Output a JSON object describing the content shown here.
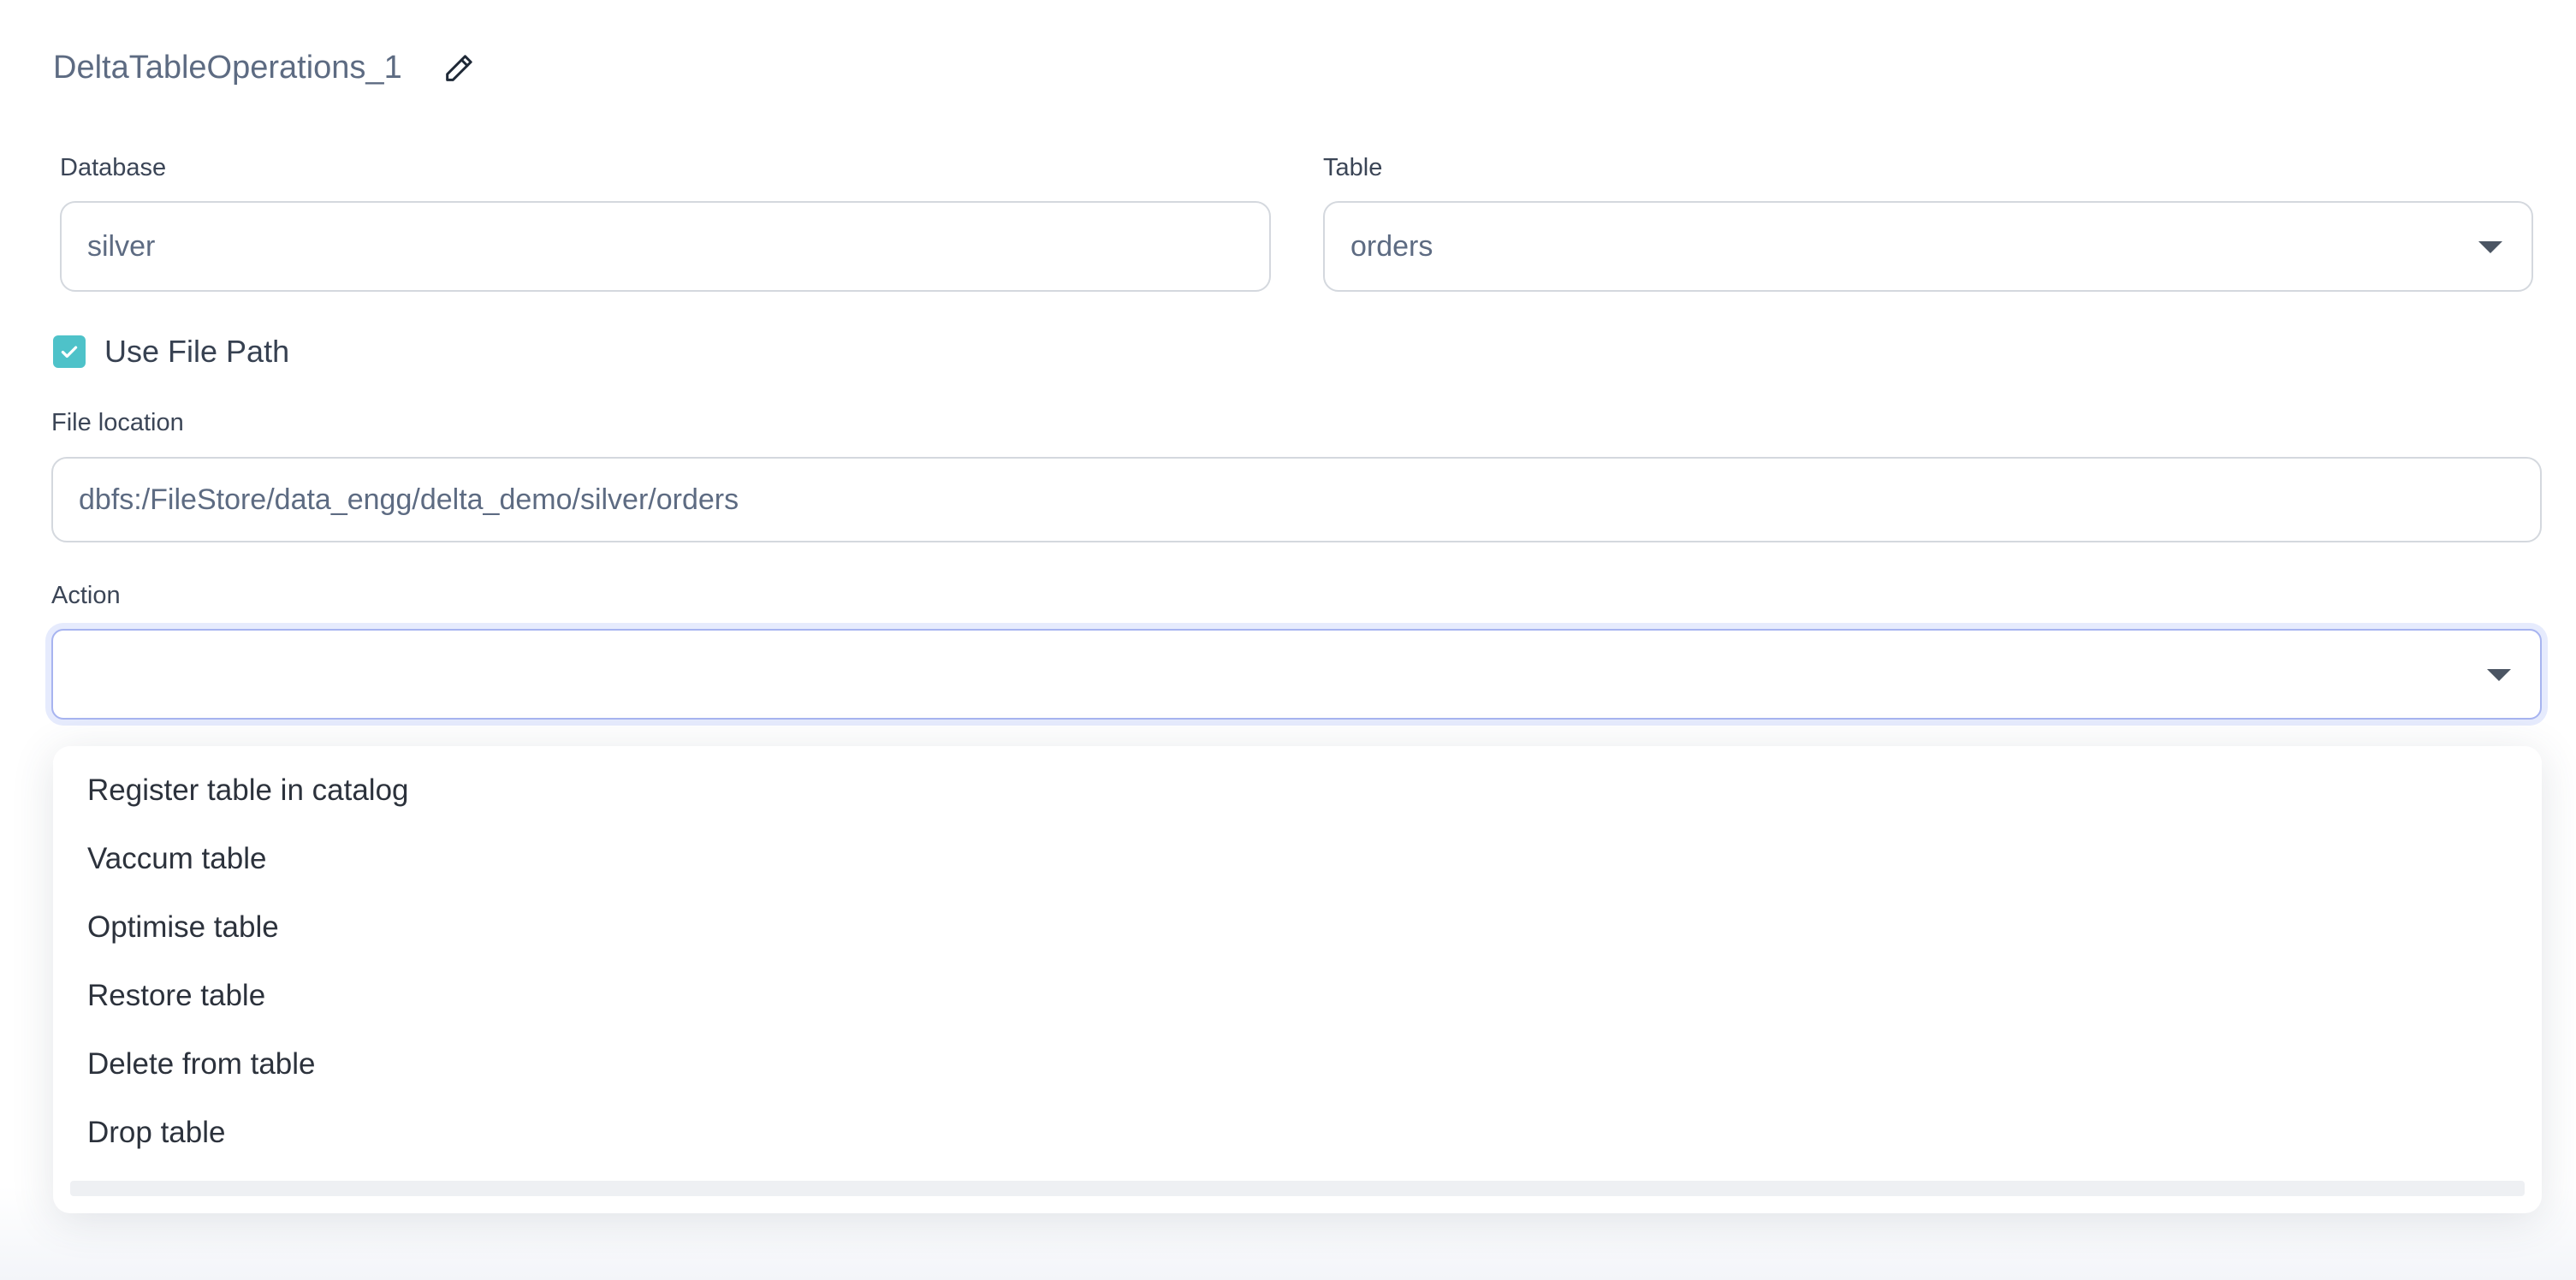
{
  "header": {
    "title": "DeltaTableOperations_1",
    "edit_icon": "pencil-icon"
  },
  "database": {
    "label": "Database",
    "value": "silver"
  },
  "table": {
    "label": "Table",
    "value": "orders"
  },
  "use_file_path": {
    "label": "Use File Path",
    "checked": true
  },
  "file_location": {
    "label": "File location",
    "value": "dbfs:/FileStore/data_engg/delta_demo/silver/orders"
  },
  "action": {
    "label": "Action",
    "value": "",
    "options": [
      "Register table in catalog",
      "Vaccum table",
      "Optimise table",
      "Restore table",
      "Delete from table",
      "Drop table"
    ]
  },
  "colors": {
    "accent": "#4ec2c9",
    "focus_border": "#a7b4f0",
    "focus_ring": "#e6ebfd",
    "muted_text": "#5d6b82"
  }
}
